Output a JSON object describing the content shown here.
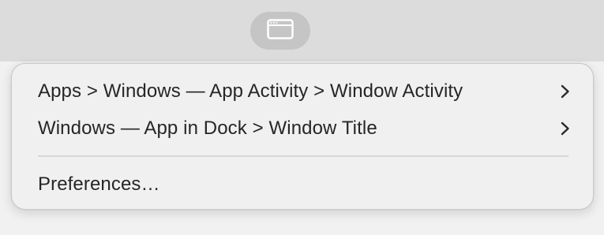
{
  "menubar": {
    "icon": "window-icon"
  },
  "menu": {
    "items": [
      {
        "label": "Apps > Windows — App Activity > Window Activity",
        "has_submenu": true
      },
      {
        "label": "Windows — App in Dock > Window Title",
        "has_submenu": true
      },
      {
        "label": "Preferences…",
        "has_submenu": false
      }
    ]
  }
}
